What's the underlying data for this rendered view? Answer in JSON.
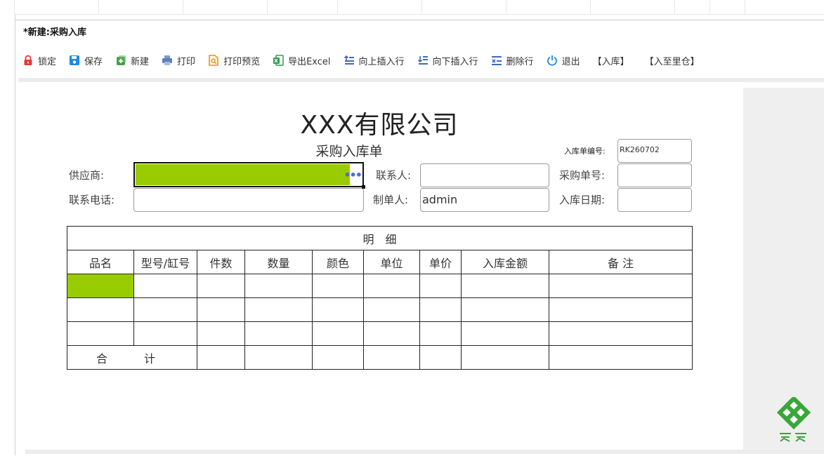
{
  "window": {
    "title": "*新建:采购入库"
  },
  "toolbar": {
    "items": [
      {
        "label": "锁定",
        "icon": "lock-icon",
        "color": "#e53935"
      },
      {
        "label": "保存",
        "icon": "save-icon",
        "color": "#1e88e5"
      },
      {
        "label": "新建",
        "icon": "new-icon",
        "color": "#43a047"
      },
      {
        "label": "打印",
        "icon": "print-icon",
        "color": "#5c7fb8"
      },
      {
        "label": "打印预览",
        "icon": "print-preview-icon",
        "color": "#fb8c00"
      },
      {
        "label": "导出Excel",
        "icon": "excel-icon",
        "color": "#2e9b4f"
      },
      {
        "label": "向上插入行",
        "icon": "insert-row-above-icon",
        "color": "#3f67c5"
      },
      {
        "label": "向下插入行",
        "icon": "insert-row-below-icon",
        "color": "#3f67c5"
      },
      {
        "label": "删除行",
        "icon": "delete-row-icon",
        "color": "#3f67c5"
      },
      {
        "label": "退出",
        "icon": "power-icon",
        "color": "#1e88e5"
      },
      {
        "label": "【入库】",
        "icon": "",
        "color": ""
      },
      {
        "label": "【入至里仓】",
        "icon": "",
        "color": ""
      }
    ]
  },
  "form": {
    "company": "XXX有限公司",
    "title": "采购入库单",
    "receipt_no_label": "入库单编号:",
    "receipt_no": "RK260702",
    "supplier_label": "供应商:",
    "supplier_value": "",
    "contact_label": "联系人:",
    "contact_value": "",
    "po_no_label": "采购单号:",
    "po_no_value": "",
    "phone_label": "联系电话:",
    "phone_value": "",
    "maker_label": "制单人:",
    "maker_value": "admin",
    "date_label": "入库日期:",
    "date_value": "",
    "highlight_color": "#99cc00"
  },
  "detail": {
    "caption": "明　细",
    "headers": [
      "品名",
      "型号/缸号",
      "件数",
      "数量",
      "颜色",
      "单位",
      "单价",
      "入库金额",
      "备 注"
    ],
    "total_label": "合　计"
  }
}
